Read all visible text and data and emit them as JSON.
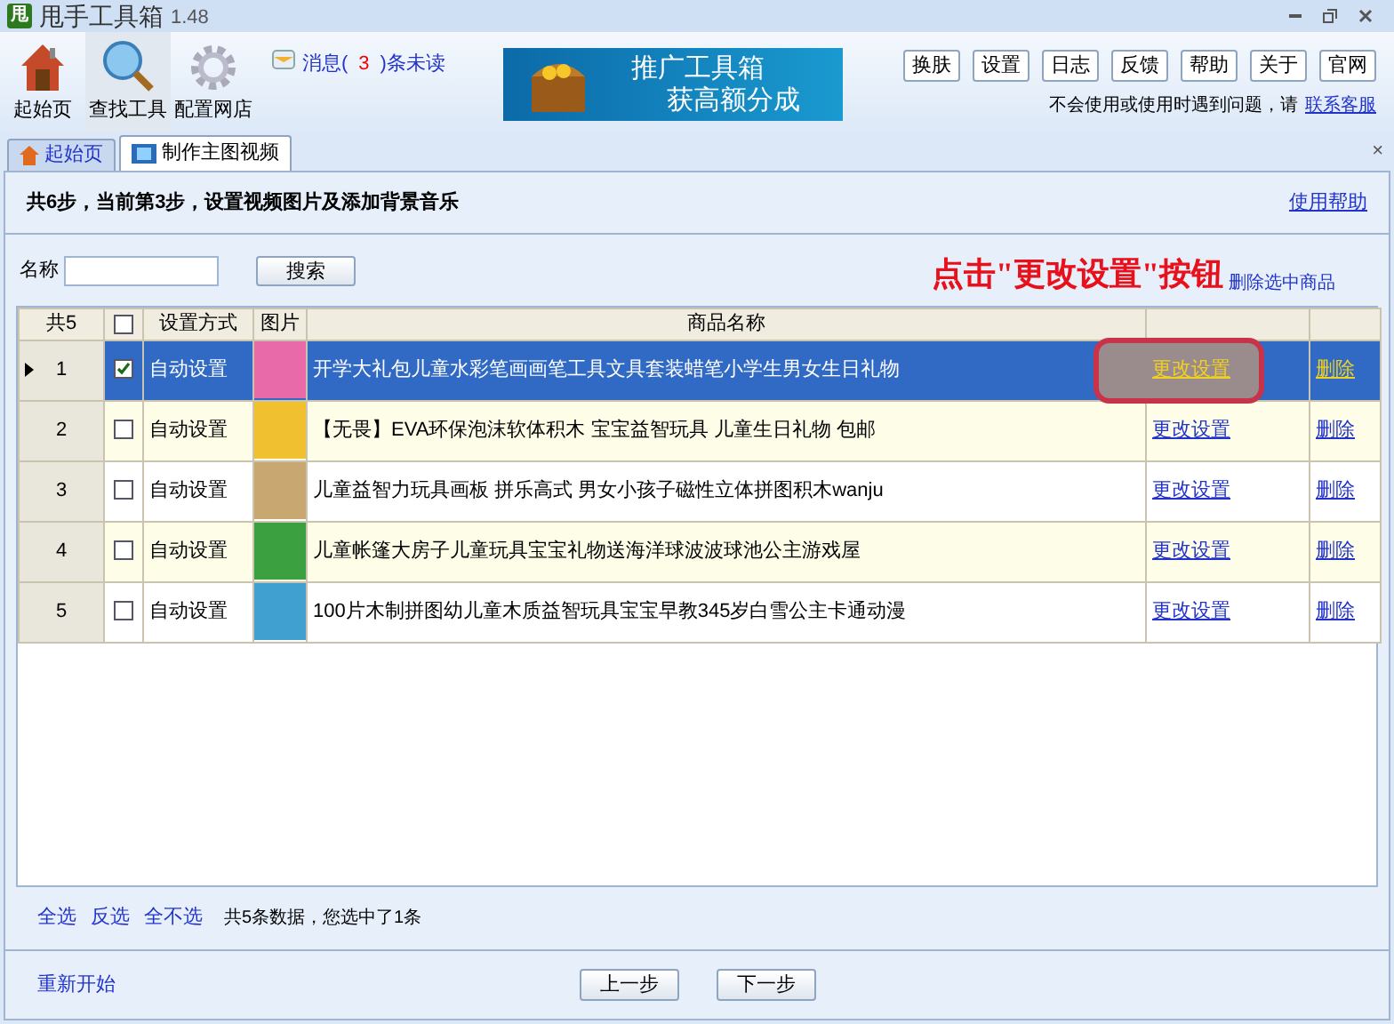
{
  "window": {
    "logo": "甩",
    "title": "甩手工具箱",
    "version": "1.48"
  },
  "toolbar": {
    "tools": [
      {
        "label": "起始页",
        "selected": false
      },
      {
        "label": "查找工具",
        "selected": true
      },
      {
        "label": "配置网店",
        "selected": false
      }
    ],
    "message": {
      "prefix": "消息(",
      "count": "3",
      "suffix": ")条未读"
    },
    "banner": {
      "line1": "推广工具箱",
      "line2": "获高额分成"
    },
    "buttons": [
      "换肤",
      "设置",
      "日志",
      "反馈",
      "帮助",
      "关于",
      "官网"
    ],
    "help_text": "不会使用或使用时遇到问题，请",
    "help_link": "联系客服"
  },
  "tabs": [
    {
      "label": "起始页",
      "selected": false
    },
    {
      "label": "制作主图视频",
      "selected": true
    }
  ],
  "tab_close": "×",
  "step": {
    "text": "共6步，当前第3步，设置视频图片及添加背景音乐",
    "help_link": "使用帮助"
  },
  "search": {
    "label": "名称",
    "button": "搜索"
  },
  "annotation": "点击\"更改设置\"按钮",
  "delete_selected": "删除选中商品",
  "table": {
    "all_checked": false,
    "columns": [
      "共5",
      "",
      "设置方式",
      "图片",
      "商品名称",
      "",
      ""
    ],
    "rows": [
      {
        "index": "1",
        "checked": true,
        "selected": true,
        "method": "自动设置",
        "name": "开学大礼包儿童水彩笔画画笔工具文具套装蜡笔小学生男女生日礼物",
        "action": "更改设置",
        "delete": "删除",
        "highlighted": true
      },
      {
        "index": "2",
        "checked": false,
        "selected": false,
        "method": "自动设置",
        "name": "【无畏】EVA环保泡沫软体积木 宝宝益智玩具 儿童生日礼物 包邮",
        "action": "更改设置",
        "delete": "删除",
        "highlighted": false
      },
      {
        "index": "3",
        "checked": false,
        "selected": false,
        "method": "自动设置",
        "name": "儿童益智力玩具画板 拼乐高式 男女小孩子磁性立体拼图积木wanju",
        "action": "更改设置",
        "delete": "删除",
        "highlighted": false
      },
      {
        "index": "4",
        "checked": false,
        "selected": false,
        "method": "自动设置",
        "name": "儿童帐篷大房子儿童玩具宝宝礼物送海洋球波波球池公主游戏屋",
        "action": "更改设置",
        "delete": "删除",
        "highlighted": false
      },
      {
        "index": "5",
        "checked": false,
        "selected": false,
        "method": "自动设置",
        "name": "100片木制拼图幼儿童木质益智玩具宝宝早教345岁白雪公主卡通动漫",
        "action": "更改设置",
        "delete": "删除",
        "highlighted": false
      }
    ]
  },
  "selection_links": [
    "全选",
    "反选",
    "全不选"
  ],
  "summary": "共5条数据，您选中了1条",
  "restart": "重新开始",
  "nav_buttons": [
    "上一步",
    "下一步"
  ]
}
